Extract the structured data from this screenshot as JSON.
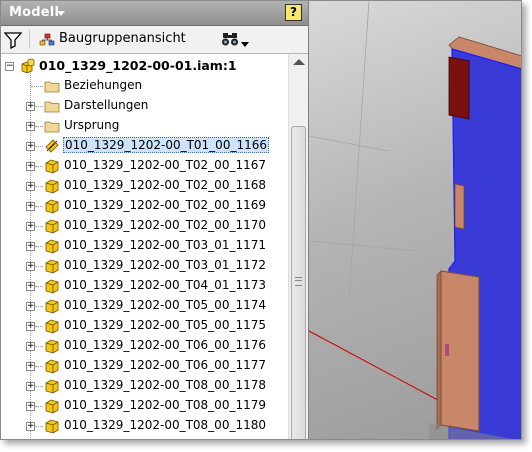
{
  "browser": {
    "title": "Modell",
    "help_label": "?",
    "toolbar": {
      "view_label": "Baugruppenansicht"
    },
    "tree": {
      "root": "010_1329_1202-00-01.iam:1",
      "folders": [
        "Beziehungen",
        "Darstellungen",
        "Ursprung"
      ],
      "parts": [
        "010_1329_1202-00_T01_00_1166",
        "010_1329_1202-00_T02_00_1167",
        "010_1329_1202-00_T02_00_1168",
        "010_1329_1202-00_T02_00_1169",
        "010_1329_1202-00_T02_00_1170",
        "010_1329_1202-00_T03_01_1171",
        "010_1329_1202-00_T03_01_1172",
        "010_1329_1202-00_T04_01_1173",
        "010_1329_1202-00_T05_00_1174",
        "010_1329_1202-00_T05_00_1175",
        "010_1329_1202-00_T06_00_1176",
        "010_1329_1202-00_T06_00_1177",
        "010_1329_1202-00_T08_00_1178",
        "010_1329_1202-00_T08_00_1179",
        "010_1329_1202-00_T08_00_1180"
      ],
      "selected": "010_1329_1202-00_T01_00_1166"
    },
    "icons": {
      "title_dropdown": "chevron-down-icon",
      "filter": "filter-icon",
      "view": "assembly-view-icon",
      "find": "binoculars-icon",
      "folder": "folder-icon",
      "part": "part-icon",
      "assembly": "assembly-icon"
    }
  },
  "viewport": {
    "colors": {
      "background": "#b5b5b5",
      "selected_panel": "#3a3ad6",
      "part_fill": "#c9876a",
      "red_part": "#7b1010",
      "axis": "#d20000"
    }
  }
}
